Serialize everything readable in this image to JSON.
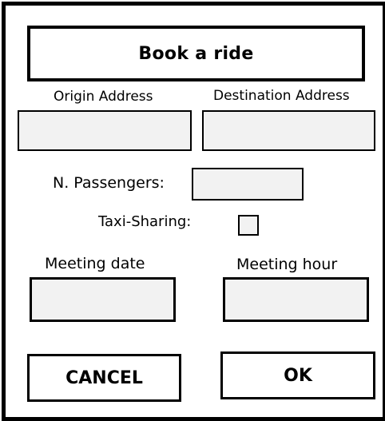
{
  "dialog": {
    "title": "Book a ride"
  },
  "fields": {
    "origin_label": "Origin Address",
    "origin_value": "",
    "destination_label": "Destination Address",
    "destination_value": "",
    "passengers_label": "N. Passengers:",
    "passengers_value": "",
    "taxi_sharing_label": "Taxi-Sharing:",
    "taxi_sharing_checked": false,
    "meeting_date_label": "Meeting date",
    "meeting_date_value": "",
    "meeting_hour_label": "Meeting hour",
    "meeting_hour_value": ""
  },
  "buttons": {
    "cancel_label": "CANCEL",
    "ok_label": "OK"
  },
  "colors": {
    "field_background": "#f2f2f2",
    "border": "#000000"
  }
}
